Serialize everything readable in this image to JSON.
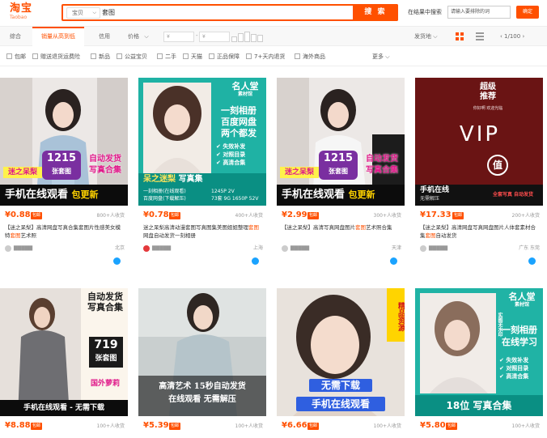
{
  "header": {
    "logo_cn": "淘宝",
    "logo_en": "Taobao",
    "search_scope": "宝贝",
    "search_query": "套图",
    "search_button": "搜 索",
    "shop_search_label": "在结果中搜索",
    "shop_search_placeholder": "请输入要排除的词",
    "shop_search_button": "确定"
  },
  "sortbar": {
    "tabs": [
      "综合",
      "销量从高到低",
      "信用",
      "价格"
    ],
    "price_from": "¥",
    "price_to": "¥",
    "dash": "-",
    "shipping": "发货地",
    "pager": "1/100"
  },
  "filters": {
    "items": [
      "包邮",
      "赠送退货运费险",
      "新品",
      "公益宝贝",
      "二手",
      "天猫",
      "正品保障",
      "7+天内退货",
      "海外商品"
    ],
    "more": "更多"
  },
  "products": [
    {
      "price": "¥0.88",
      "badge": "包邮",
      "sold": "800+人收货",
      "title_pre": "【迷之呆梨】高清网盘写真合集套图片性感美女模特",
      "title_hl": "套图",
      "title_post": "艺术照",
      "location": "北京",
      "art": {
        "num": "1215",
        "num_sub": "张套图",
        "side1": "自动发货",
        "side2": "写真合集",
        "tag": "迷之呆梨",
        "bar": "手机在线观看",
        "bar2": "包更新"
      }
    },
    {
      "price": "¥0.78",
      "badge": "包邮",
      "sold": "400+人收货",
      "title_pre": "迷之呆梨高清动漫套图写真图集美图姐姐整理",
      "title_hl": "套图",
      "title_post": "网盘自动发货一刻相册",
      "location": "上海",
      "art": {
        "top": "名人堂",
        "top_sub": "素材馆",
        "t1": "一刻相册",
        "t2": "百度网盘",
        "t3": "两个都发",
        "f1": "失效补发",
        "f2": "对照目录",
        "f3": "高清合集",
        "name": "呆之迷梨",
        "name2": "写真集",
        "line1": "一刻相册(在线观看)",
        "line2": "百度网盘(下载解压)",
        "line3": "1245P 2V",
        "line4": "73套 9G 1650P 52V"
      }
    },
    {
      "price": "¥2.99",
      "badge": "包邮",
      "sold": "300+人收货",
      "title_pre": "【迷之呆梨】高清写真网盘图片",
      "title_hl": "套图",
      "title_post": "艺术照合集",
      "location": "天津",
      "art": {
        "num": "1215",
        "num_sub": "张套图",
        "side1": "自动发货",
        "side2": "写真合集",
        "tag": "迷之呆梨",
        "bar": "手机在线观看",
        "bar2": "包更新"
      }
    },
    {
      "price": "¥17.33",
      "badge": "包邮",
      "sold": "200+人收货",
      "title_pre": "【迷之呆梨】高清网盘写真网盘图片人体套素材合集",
      "title_hl": "套图",
      "title_post": "自动发货",
      "location": "广东 东莞",
      "art": {
        "top1": "超级",
        "top2": "推荐",
        "sub": "你好啊  欢迎光临",
        "vip": "VIP",
        "seal": "值",
        "bar": "手机在线",
        "bar_sub": "无需解压",
        "tags": "全套写真 自动发货"
      }
    },
    {
      "price": "¥8.88",
      "badge": "包邮",
      "sold": "100+人收货",
      "art": {
        "side1": "自动发货",
        "side2": "写真合集",
        "num": "719",
        "num_sub": "张套图",
        "tag": "国外萝莉",
        "bar": "手机在线观看 - 无需下载"
      }
    },
    {
      "price": "¥5.39",
      "badge": "包邮",
      "sold": "100+人收货",
      "art": {
        "line1": "高清艺术 15秒自动发货",
        "line2": "在线观看 无需解压"
      }
    },
    {
      "price": "¥6.66",
      "badge": "包邮",
      "sold": "100+人收货",
      "art": {
        "corner": "精品资源",
        "line1": "无需下载",
        "line2": "手机在线观看"
      }
    },
    {
      "price": "¥5.80",
      "badge": "包邮",
      "sold": "100+人收货",
      "art": {
        "top": "名人堂",
        "top_sub": "素材馆",
        "side": "实图无水印",
        "t1": "一刻相册",
        "t2": "在线学习",
        "f1": "失效补发",
        "f2": "对照目录",
        "f3": "高清合集",
        "bar": "18位  写真合集"
      }
    }
  ],
  "colors": {
    "brand": "#ff5000",
    "link": "#1aa3ff"
  }
}
